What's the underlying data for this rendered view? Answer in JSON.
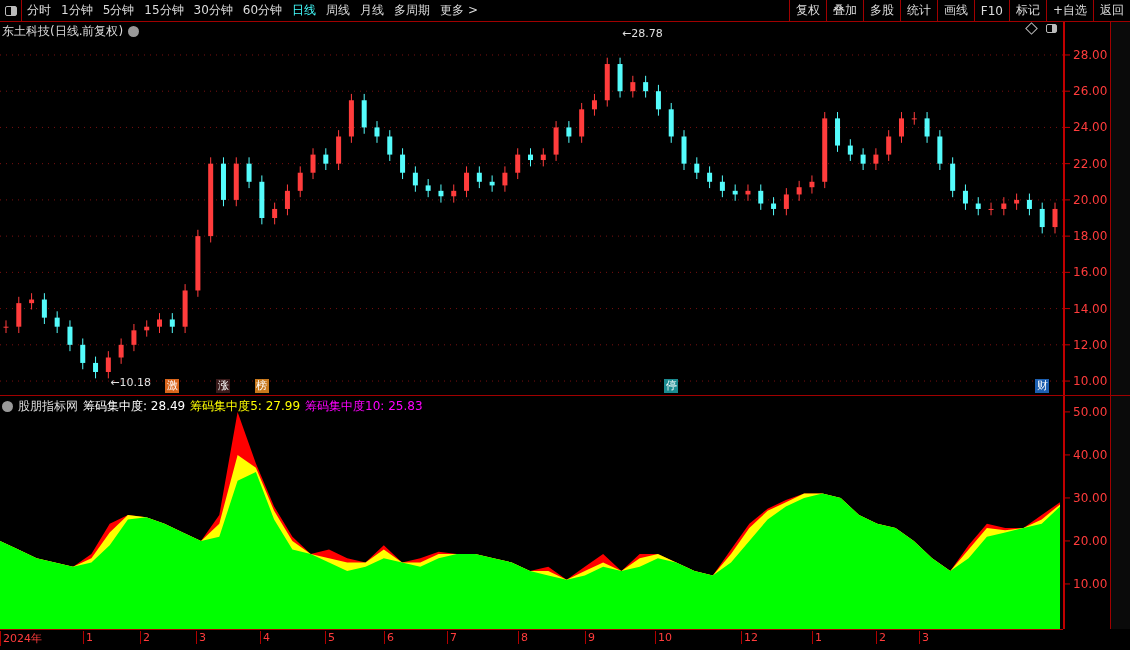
{
  "toolbar": {
    "periods": [
      {
        "label": "分时",
        "selected": false
      },
      {
        "label": "1分钟",
        "selected": false
      },
      {
        "label": "5分钟",
        "selected": false
      },
      {
        "label": "15分钟",
        "selected": false
      },
      {
        "label": "30分钟",
        "selected": false
      },
      {
        "label": "60分钟",
        "selected": false
      },
      {
        "label": "日线",
        "selected": true
      },
      {
        "label": "周线",
        "selected": false
      },
      {
        "label": "月线",
        "selected": false
      },
      {
        "label": "多周期",
        "selected": false
      },
      {
        "label": "更多 >",
        "selected": false
      }
    ],
    "buttons": [
      "复权",
      "叠加",
      "多股",
      "统计",
      "画线",
      "F10",
      "标记",
      "+自选",
      "返回"
    ]
  },
  "price_chart": {
    "title": "东土科技(日线.前复权)",
    "high_label": "←28.78",
    "low_label": "←10.18",
    "markers": [
      {
        "label": "激",
        "color": "#d9651c"
      },
      {
        "label": "涨",
        "color": "#3a1a1a"
      },
      {
        "label": "榜",
        "color": "#c8781c"
      },
      {
        "label": "停",
        "color": "#1b8a90"
      },
      {
        "label": "财",
        "color": "#1d5fb0"
      }
    ],
    "axis_labels": [
      "28.00",
      "26.00",
      "24.00",
      "22.00",
      "20.00",
      "18.00",
      "16.00",
      "14.00",
      "12.00",
      "10.00"
    ]
  },
  "indicator": {
    "name": "股朋指标网",
    "legend": [
      {
        "label": "筹码集中度: 28.49",
        "color": "#ffffff"
      },
      {
        "label": "筹码集中度5: 27.99",
        "color": "#ffff00"
      },
      {
        "label": "筹码集中度10: 25.83",
        "color": "#ff00ff"
      }
    ],
    "axis_labels": [
      "50.00",
      "40.00",
      "30.00",
      "20.00",
      "10.00"
    ]
  },
  "time_axis": [
    "2024年",
    "1",
    "2",
    "3",
    "4",
    "5",
    "6",
    "7",
    "8",
    "9",
    "10",
    "12",
    "1",
    "2",
    "3"
  ]
}
